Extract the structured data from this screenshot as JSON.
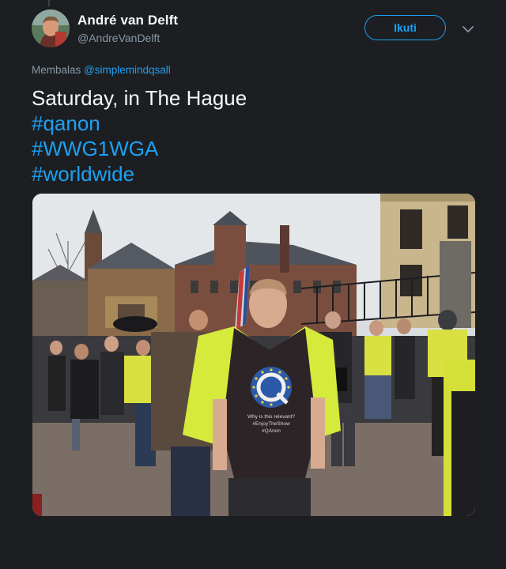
{
  "tweet": {
    "author": {
      "display_name": "André van Delft",
      "handle": "@AndreVanDelft",
      "avatar_icon": "user-avatar"
    },
    "follow_label": "Ikuti",
    "more_icon": "chevron-down-icon",
    "reply_context": {
      "prefix": "Membalas",
      "mention": "@simplemindqsall"
    },
    "text_lines": [
      {
        "text": "Saturday, in The Hague",
        "type": "text"
      },
      {
        "text": "#qanon",
        "type": "hashtag"
      },
      {
        "text": "#WWG1WGA",
        "type": "hashtag"
      },
      {
        "text": "#worldwide",
        "type": "hashtag"
      }
    ],
    "photo": {
      "shirt_text": [
        "Why is this relevant?",
        "#EnjoyTheShow",
        "#QAnon"
      ],
      "shirt_logo": "Q"
    }
  },
  "colors": {
    "background": "#1c1e22",
    "accent": "#1da1f2",
    "secondary_text": "#8899a6",
    "primary_text": "#f5f8fa"
  }
}
